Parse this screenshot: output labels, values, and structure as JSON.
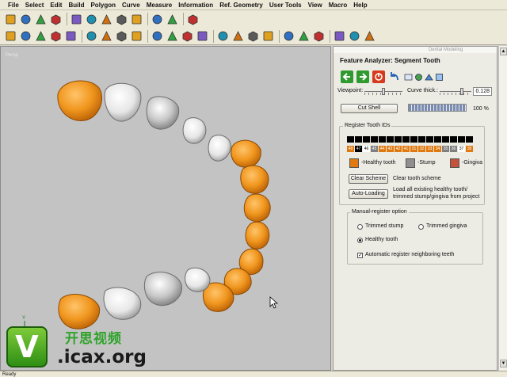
{
  "menu": [
    "File",
    "Select",
    "Edit",
    "Build",
    "Polygon",
    "Curve",
    "Measure",
    "Information",
    "Ref. Geometry",
    "User Tools",
    "View",
    "Macro",
    "Help"
  ],
  "toolbar1": [
    "new-file-icon",
    "open-file-icon",
    "save-icon",
    "print-icon",
    "import-icon",
    "export-icon",
    "copy-icon",
    "cut-icon",
    "delete-icon",
    "undo-icon",
    "redo-icon",
    "select-arrow-icon"
  ],
  "toolbar2": [
    "zoom-icon",
    "zoom-window-icon",
    "zoom-fit-icon",
    "rotate-icon",
    "pan-icon",
    "front-view-icon",
    "top-view-icon",
    "side-view-icon",
    "iso-view-icon",
    "shade-icon",
    "wireframe-icon",
    "render-icon",
    "check-icon",
    "material-icon",
    "texture-icon",
    "globe-icon",
    "sphere-icon",
    "trim-icon",
    "measure-icon",
    "grid-icon",
    "lightning-icon",
    "color-icon",
    "filter-icon"
  ],
  "viewport": {
    "label": "Persp"
  },
  "panel": {
    "caption": "Dental Modeling",
    "title": "Feature Analyzer: Segment Tooth",
    "icons": [
      "back-arrow-icon",
      "forward-arrow-icon",
      "stop-icon",
      "undo-icon",
      "help-icon",
      "settings-icon",
      "info-icon",
      "view-icon"
    ],
    "viewpoint_label": "Viewpoint:",
    "viewpoint_value": 0.5,
    "curve_label": "Curve thick.:",
    "curve_value": "0.128",
    "cut_shell": "Cut Shell",
    "progress_percent": "100 %",
    "progress_fraction": 1.0,
    "register_title": "Register Tooth IDs",
    "tooth_ids": [
      "48",
      "47",
      "46",
      "45",
      "44",
      "43",
      "42",
      "41",
      "31",
      "32",
      "33",
      "34",
      "35",
      "36",
      "37",
      "38"
    ],
    "tooth_colors": [
      "#e07a10",
      "#000000",
      "#ffffff",
      "#7f7f7f",
      "#e07a10",
      "#e07a10",
      "#e07a10",
      "#e07a10",
      "#e07a10",
      "#e07a10",
      "#e07a10",
      "#e07a10",
      "#7f7f7f",
      "#7f7f7f",
      "#ffffff",
      "#e07a10"
    ],
    "legend": [
      {
        "label": "-Healthy tooth",
        "color": "#e07a10"
      },
      {
        "label": "-Stump",
        "color": "#8f8f8f"
      },
      {
        "label": "-Gingiva",
        "color": "#c2523a"
      }
    ],
    "clear_scheme": "Clear Scheme",
    "clear_scheme_desc": "Clear tooth scheme",
    "auto_loading": "Auto-Loading",
    "auto_loading_desc_1": "Load all existing healthy tooth/",
    "auto_loading_desc_2": "trimmed stump/gingiva from project",
    "manual_title": "Manual-register option",
    "opt_trimmed_stump": "Trimmed stump",
    "opt_trimmed_gingiva": "Trimmed gingiva",
    "opt_healthy_tooth": "Healthy tooth",
    "opt_auto_register": "Automatic register neighboring teeth"
  },
  "watermark": {
    "logo": "V",
    "cn": "开思视频",
    "url": ".icax.org"
  },
  "status": "Ready"
}
